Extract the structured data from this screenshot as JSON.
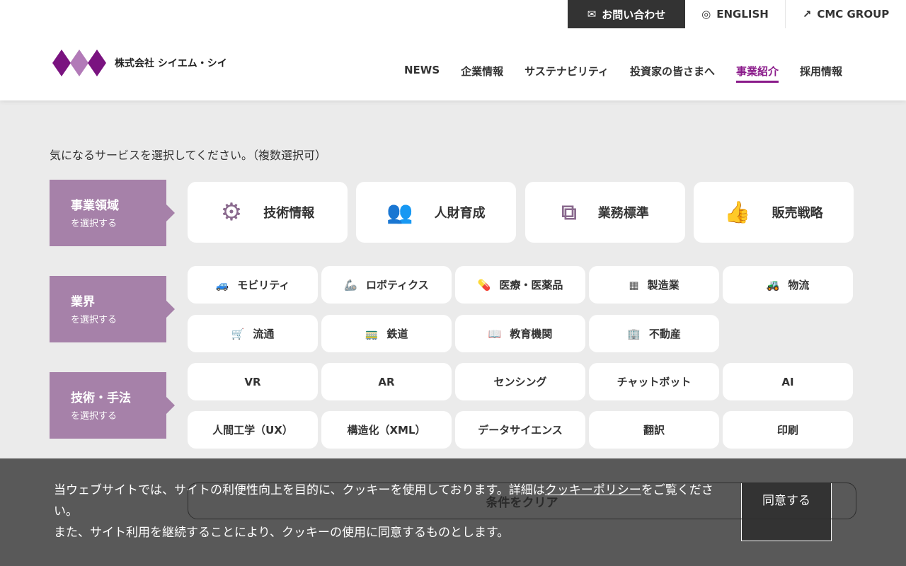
{
  "util": {
    "contact": "お問い合わせ",
    "english": "ENGLISH",
    "group": "CMC GROUP"
  },
  "logo": {
    "company": "株式会社 シイエム・シイ"
  },
  "nav": [
    "NEWS",
    "企業情報",
    "サステナビリティ",
    "投資家の皆さまへ",
    "事業紹介",
    "採用情報"
  ],
  "intro": "気になるサービスを選択してください。（複数選択可）",
  "categories": [
    {
      "title": "事業領域",
      "sub": "を選択する"
    },
    {
      "title": "業界",
      "sub": "を選択する"
    },
    {
      "title": "技術・手法",
      "sub": "を選択する"
    }
  ],
  "domains": [
    "技術情報",
    "人財育成",
    "業務標準",
    "販売戦略"
  ],
  "industries": [
    "モビリティ",
    "ロボティクス",
    "医療・医薬品",
    "製造業",
    "物流",
    "流通",
    "鉄道",
    "教育機関",
    "不動産"
  ],
  "techniques": [
    "VR",
    "AR",
    "センシング",
    "チャットボット",
    "AI",
    "人間工学（UX）",
    "構造化（XML）",
    "データサイエンス",
    "翻訳",
    "印刷"
  ],
  "clear": "条件をクリア",
  "cookie": {
    "text1": "当ウェブサイトでは、サイトの利便性向上を目的に、クッキーを使用しております。詳細は",
    "link": "クッキーポリシー",
    "text2": "をご覧ください。",
    "text3": "また、サイト利用を継続することにより、クッキーの使用に同意するものとします。",
    "agree": "同意する"
  },
  "colors": {
    "accent": "#8a1a8a",
    "category": "#a681a9"
  }
}
